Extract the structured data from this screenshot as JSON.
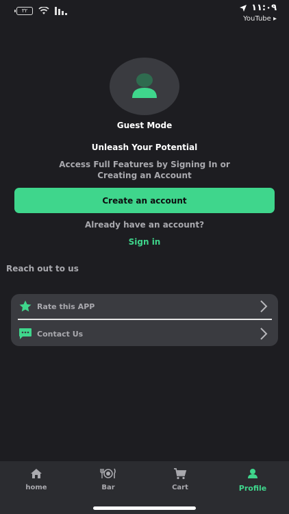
{
  "status_bar": {
    "battery_level": "٣٢",
    "time": "١١:٠٩",
    "back_app": "YouTube ▸"
  },
  "profile": {
    "mode_label": "Guest Mode",
    "headline": "Unleash Your Potential",
    "subline": "Access Full Features by Signing In or Creating an Account",
    "create_account_label": "Create an account",
    "already_label": "Already have an account?",
    "sign_in_label": "Sign in"
  },
  "contact": {
    "section_title": "Reach out to us",
    "items": [
      {
        "label": "Rate this APP",
        "icon": "star-icon"
      },
      {
        "label": "Contact Us",
        "icon": "chat-icon"
      }
    ]
  },
  "tabs": [
    {
      "label": "home",
      "icon": "home-icon"
    },
    {
      "label": "Bar",
      "icon": "dining-icon"
    },
    {
      "label": "Cart",
      "icon": "cart-icon"
    },
    {
      "label": "Profile",
      "icon": "person-icon",
      "active": true
    }
  ],
  "colors": {
    "background": "#1d1d21",
    "accent": "#3fd68c",
    "card": "#3a3b40",
    "muted_text": "#a9a9ae",
    "tab_bar": "#2b2c30"
  }
}
